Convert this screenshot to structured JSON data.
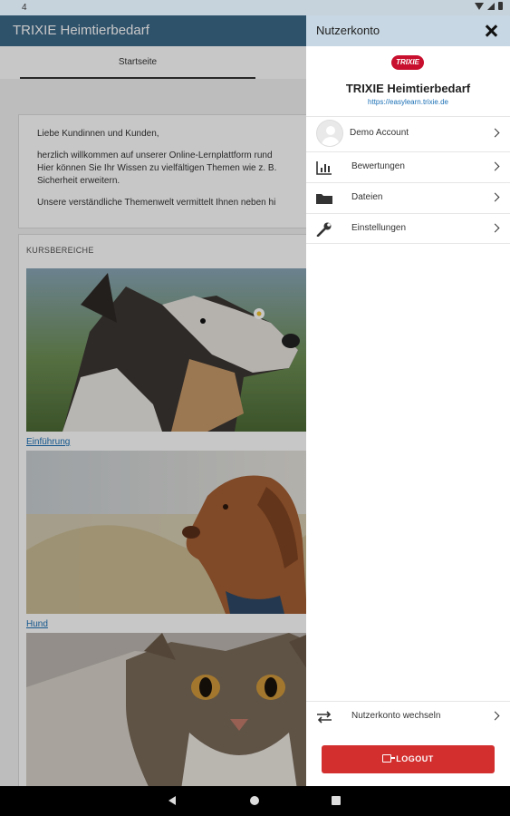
{
  "status_bar": {
    "time": "4"
  },
  "app": {
    "title": "TRIXIE Heimtierbedarf",
    "tab_label": "Startseite",
    "welcome": {
      "greeting": "Liebe Kundinnen und Kunden,",
      "line1": "herzlich willkommen auf unserer Online-Lernplattform rund",
      "line2": "Hier können Sie Ihr Wissen zu vielfältigen Themen wie z. B.",
      "line3": "Sicherheit erweitern.",
      "line4": "Unsere verständliche Themenwelt vermittelt Ihnen neben hi"
    },
    "course_section_header": "KURSBEREICHE",
    "courses": [
      {
        "label": "Einführung"
      },
      {
        "label": "Hund"
      }
    ]
  },
  "drawer": {
    "title": "Nutzerkonto",
    "logo_text": "TRIXIE",
    "site_name": "TRIXIE Heimtierbedarf",
    "site_url": "https://easylearn.trixie.de",
    "account_name": "Demo Account",
    "menu": [
      {
        "label": "Bewertungen",
        "icon": "bar-chart-icon"
      },
      {
        "label": "Dateien",
        "icon": "folder-icon"
      },
      {
        "label": "Einstellungen",
        "icon": "wrench-icon"
      }
    ],
    "switch_account": "Nutzerkonto wechseln",
    "logout": "LOGOUT"
  },
  "colors": {
    "app_bar": "#3d6a8a",
    "drawer_header": "#c7d7e3",
    "logout": "#d32f2f",
    "link": "#1a6fb5"
  }
}
